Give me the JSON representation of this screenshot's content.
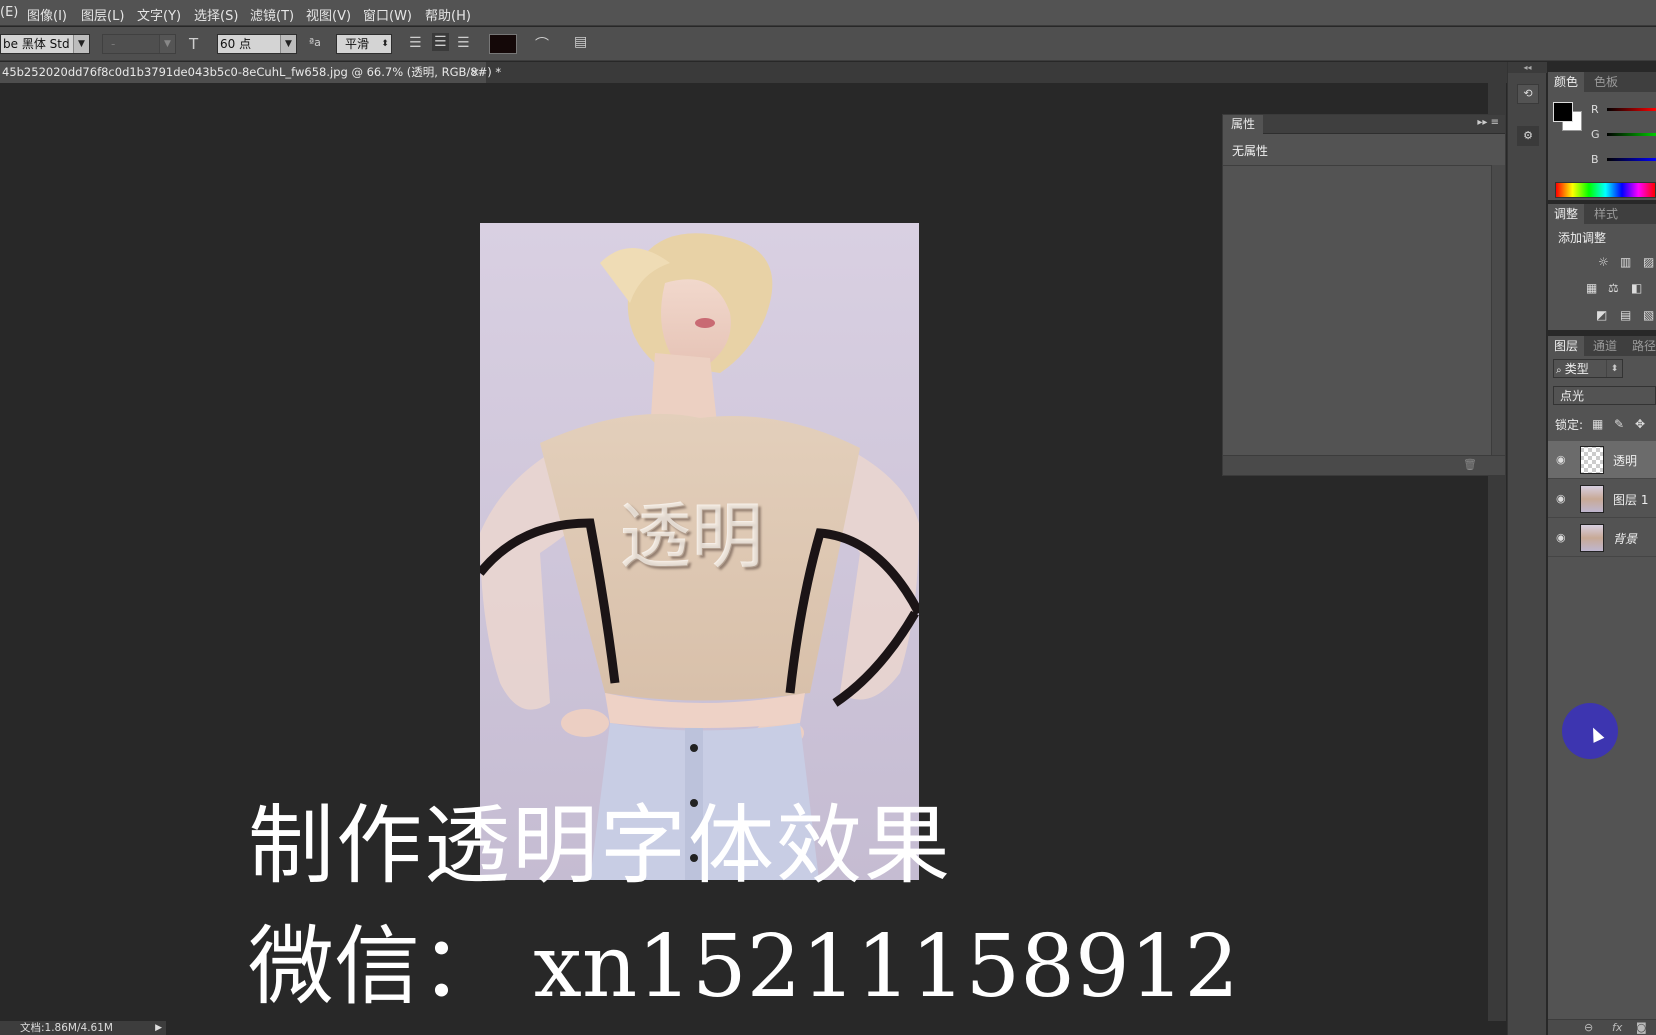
{
  "menu": {
    "items": [
      "(E)",
      "图像(I)",
      "图层(L)",
      "文字(Y)",
      "选择(S)",
      "滤镜(T)",
      "视图(V)",
      "窗口(W)",
      "帮助(H)"
    ]
  },
  "options_bar": {
    "font_family": "be 黑体 Std",
    "font_style": "-",
    "font_size": "60 点",
    "antialias": "平滑",
    "text_color": "#140808",
    "icons": [
      "type-orientation-icon",
      "font-size-icon",
      "antialias-icon",
      "align-left-icon",
      "align-center-icon",
      "align-right-icon",
      "warp-text-icon",
      "character-panel-icon"
    ]
  },
  "document": {
    "tab_title": "45b252020dd76f8c0d1b3791de043b5c0-8eCuhL_fw658.jpg @ 66.7% (透明, RGB/8#) *",
    "close": "×"
  },
  "canvas": {
    "embossed_text": "透明",
    "overlay_line1": "制作透明字体效果",
    "overlay_line2": "微信： xn15211158912"
  },
  "properties_panel": {
    "tab": "属性",
    "content": "无属性"
  },
  "color_panel": {
    "tabs": [
      "颜色",
      "色板"
    ],
    "foreground": "#000000",
    "background": "#ffffff",
    "channels": [
      "R",
      "G",
      "B"
    ]
  },
  "adjustments_panel": {
    "tabs": [
      "调整",
      "样式"
    ],
    "title": "添加调整"
  },
  "layers_panel": {
    "tabs": [
      "图层",
      "通道",
      "路径"
    ],
    "filter": "类型",
    "blend_mode": "点光",
    "lock_label": "锁定:",
    "layers": [
      {
        "name": "透明",
        "selected": true
      },
      {
        "name": "图层 1",
        "selected": false
      },
      {
        "name": "背景",
        "selected": false
      }
    ],
    "footer_icons": [
      "link-icon",
      "fx-icon",
      "mask-icon"
    ],
    "fx_label": "fx"
  },
  "status": {
    "doc_size": "文档:1.86M/4.61M"
  },
  "colors": {
    "panel": "#535353",
    "canvas_bg": "#282828",
    "cursor_highlight": "#3d35b0"
  }
}
